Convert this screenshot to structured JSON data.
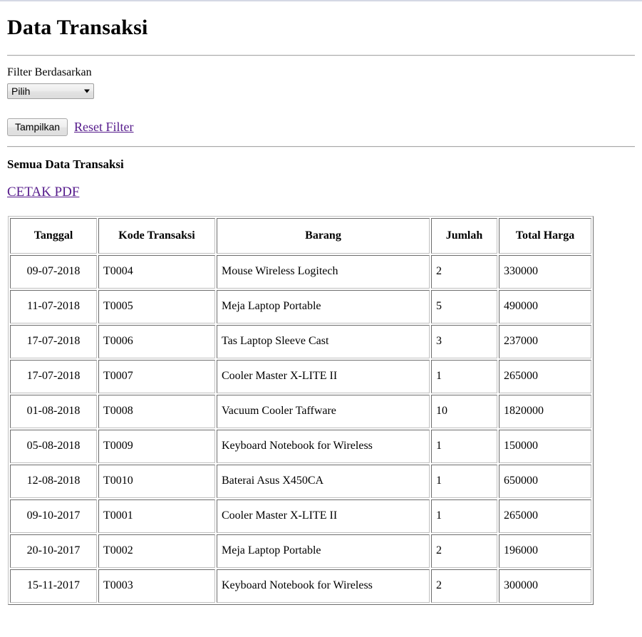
{
  "page": {
    "title": "Data Transaksi"
  },
  "filter": {
    "label": "Filter Berdasarkan",
    "select_value": "Pilih",
    "select_options": [
      "Pilih"
    ],
    "show_button": "Tampilkan",
    "reset_link": "Reset Filter"
  },
  "section": {
    "heading": "Semua Data Transaksi",
    "pdf_link": "CETAK PDF"
  },
  "table": {
    "columns": [
      "Tanggal",
      "Kode Transaksi",
      "Barang",
      "Jumlah",
      "Total Harga"
    ],
    "rows": [
      {
        "tanggal": "09-07-2018",
        "kode": "T0004",
        "barang": "Mouse Wireless Logitech",
        "jumlah": "2",
        "total": "330000"
      },
      {
        "tanggal": "11-07-2018",
        "kode": "T0005",
        "barang": "Meja Laptop Portable",
        "jumlah": "5",
        "total": "490000"
      },
      {
        "tanggal": "17-07-2018",
        "kode": "T0006",
        "barang": "Tas Laptop Sleeve Cast",
        "jumlah": "3",
        "total": "237000"
      },
      {
        "tanggal": "17-07-2018",
        "kode": "T0007",
        "barang": "Cooler Master X-LITE II",
        "jumlah": "1",
        "total": "265000"
      },
      {
        "tanggal": "01-08-2018",
        "kode": "T0008",
        "barang": "Vacuum Cooler Taffware",
        "jumlah": "10",
        "total": "1820000"
      },
      {
        "tanggal": "05-08-2018",
        "kode": "T0009",
        "barang": "Keyboard Notebook for Wireless",
        "jumlah": "1",
        "total": "150000"
      },
      {
        "tanggal": "12-08-2018",
        "kode": "T0010",
        "barang": "Baterai Asus X450CA",
        "jumlah": "1",
        "total": "650000"
      },
      {
        "tanggal": "09-10-2017",
        "kode": "T0001",
        "barang": "Cooler Master X-LITE II",
        "jumlah": "1",
        "total": "265000"
      },
      {
        "tanggal": "20-10-2017",
        "kode": "T0002",
        "barang": "Meja Laptop Portable",
        "jumlah": "2",
        "total": "196000"
      },
      {
        "tanggal": "15-11-2017",
        "kode": "T0003",
        "barang": "Keyboard Notebook for Wireless",
        "jumlah": "2",
        "total": "300000"
      }
    ]
  },
  "colors": {
    "link": "#551A8B",
    "text": "#000000",
    "rule": "#a9a9a9"
  }
}
